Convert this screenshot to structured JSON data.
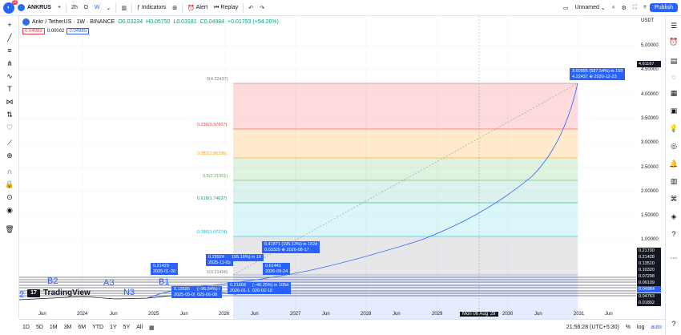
{
  "toolbar": {
    "badge": "11",
    "symbol": "ANKRUS",
    "add_symbol": "+",
    "interval": "2h",
    "intervals": [
      "D",
      "W"
    ],
    "indicators": "Indicators",
    "alert": "Alert",
    "replay": "Replay",
    "layout_name": "Unnamed",
    "publish": "Publish"
  },
  "legend": {
    "title": "Ankr / TetherUS · 1W · BINANCE",
    "o": "O0.03234",
    "h": "H0.05750",
    "l": "L0.03181",
    "c": "C0.04984",
    "change": "+0.01753 (+54.26%)",
    "bid": "0.04983",
    "spread": "0.00002",
    "ask": "0.04985"
  },
  "currency": "USDT",
  "fib_levels": [
    {
      "label": "0(4.22437)",
      "color": "#787b86"
    },
    {
      "label": "0.236(3.37807)",
      "color": "#f23645"
    },
    {
      "label": "0.382(2.86396)",
      "color": "#ff9800"
    },
    {
      "label": "0.5(2.21951)",
      "color": "#4caf50"
    },
    {
      "label": "0.618(1.74637)",
      "color": "#089981"
    },
    {
      "label": "0.786(1.07274)",
      "color": "#00bcd4"
    },
    {
      "label": "1(0.21466)",
      "color": "#787b86"
    }
  ],
  "price_axis": [
    "5.00000",
    "4.50000",
    "4.00000",
    "3.50000",
    "3.00000",
    "2.50000",
    "2.00000",
    "1.50000",
    "1.00000"
  ],
  "price_tags": [
    {
      "label": "4.61167",
      "color": "#131722"
    },
    {
      "label": "0.21700",
      "color": "#131722"
    },
    {
      "label": "0.21428",
      "color": "#131722"
    },
    {
      "label": "0.13510",
      "color": "#131722"
    },
    {
      "label": "0.10320",
      "color": "#131722"
    },
    {
      "label": "0.07298",
      "color": "#131722"
    },
    {
      "label": "0.06109",
      "color": "#131722"
    },
    {
      "label": "0.04984",
      "color": "#2962ff"
    },
    {
      "label": "0.04763",
      "color": "#131722"
    },
    {
      "label": "0.01892",
      "color": "#131722"
    }
  ],
  "date_axis": [
    "Jun",
    "2024",
    "Jun",
    "2025",
    "Jun",
    "2026",
    "Jun",
    "2027",
    "Jun",
    "2028",
    "Jun",
    "2029",
    "Jun",
    "2030",
    "Jun",
    "2031",
    "Jun"
  ],
  "crosshair_date": "Mon 06 Aug '29",
  "labels": {
    "big_target": "3.60995 (587.54%) in 168",
    "big_target_sub": "4.22437 ⊕ 2030-12-23",
    "p1": "0.21429",
    "p1_sub": "2025-01-20",
    "p2": "0.29924",
    "p2_sub": "2025-11-03",
    "p3": "195.18%) in 18",
    "p4": "0.41871 (195.13%) in 182d",
    "p4_sub": "0.03329 ⊕ 2026-08-17",
    "p5": "0.61441",
    "p5_sub": "2026-09-24",
    "p6": "0.13526",
    "p6_sub": "2025-05-05",
    "p7": "(−96.84%) i",
    "p7_sub": "025-06-08",
    "p8": "0.21658",
    "p8_sub": "2026-01-15",
    "p9": "(−46.25%) in 105d",
    "p9_sub": "026-02-18"
  },
  "wave_labels": [
    "B2",
    "A3",
    "B1",
    "N3",
    "2"
  ],
  "brand": "TradingView",
  "bottom": {
    "ranges": [
      "1D",
      "5D",
      "1M",
      "3M",
      "6M",
      "YTD",
      "1Y",
      "5Y",
      "All"
    ],
    "time": "21:56:28 (UTC+5:30)",
    "pct": "%",
    "log": "log",
    "auto": "auto"
  }
}
